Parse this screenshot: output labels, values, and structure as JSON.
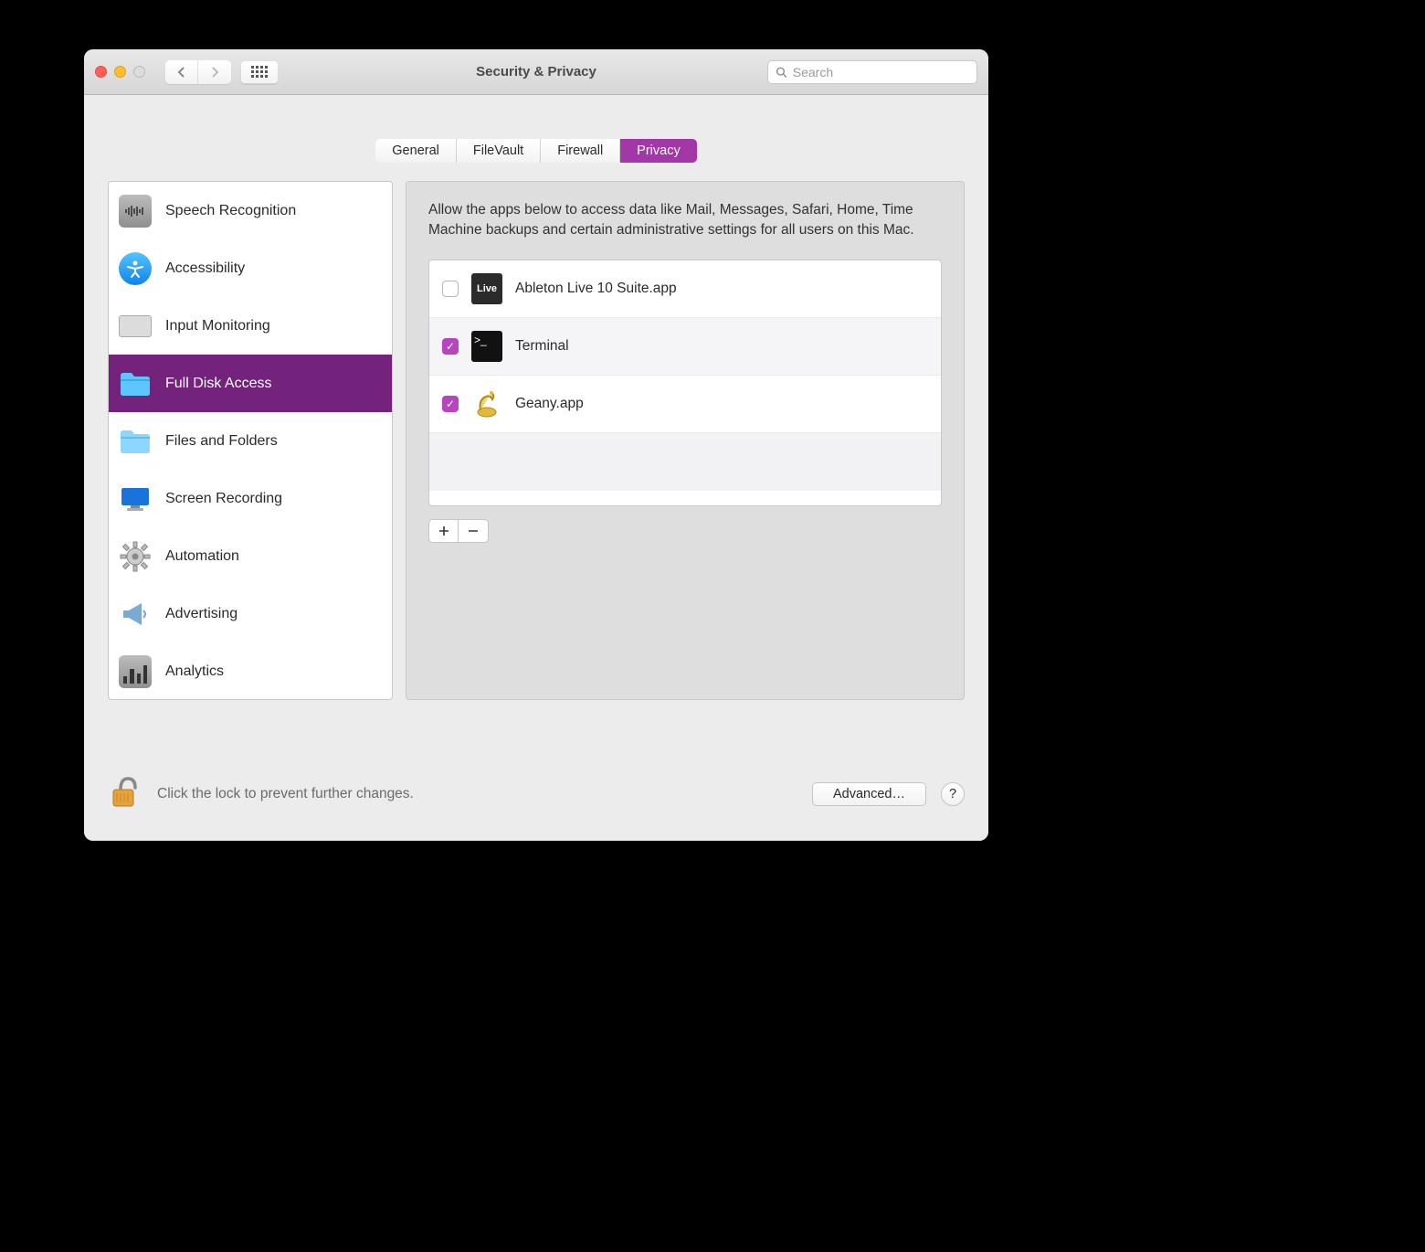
{
  "window": {
    "title": "Security & Privacy"
  },
  "search": {
    "placeholder": "Search"
  },
  "tabs": [
    {
      "label": "General"
    },
    {
      "label": "FileVault"
    },
    {
      "label": "Firewall"
    },
    {
      "label": "Privacy",
      "active": true
    }
  ],
  "sidebar": {
    "items": [
      {
        "label": "Speech Recognition"
      },
      {
        "label": "Accessibility"
      },
      {
        "label": "Input Monitoring"
      },
      {
        "label": "Full Disk Access",
        "selected": true
      },
      {
        "label": "Files and Folders"
      },
      {
        "label": "Screen Recording"
      },
      {
        "label": "Automation"
      },
      {
        "label": "Advertising"
      },
      {
        "label": "Analytics"
      }
    ]
  },
  "detail": {
    "description": "Allow the apps below to access data like Mail, Messages, Safari, Home, Time Machine backups and certain administrative settings for all users on this Mac.",
    "apps": [
      {
        "name": "Ableton Live 10 Suite.app",
        "checked": false
      },
      {
        "name": "Terminal",
        "checked": true
      },
      {
        "name": "Geany.app",
        "checked": true
      }
    ]
  },
  "footer": {
    "lock_text": "Click the lock to prevent further changes.",
    "advanced_label": "Advanced…",
    "help_label": "?"
  }
}
